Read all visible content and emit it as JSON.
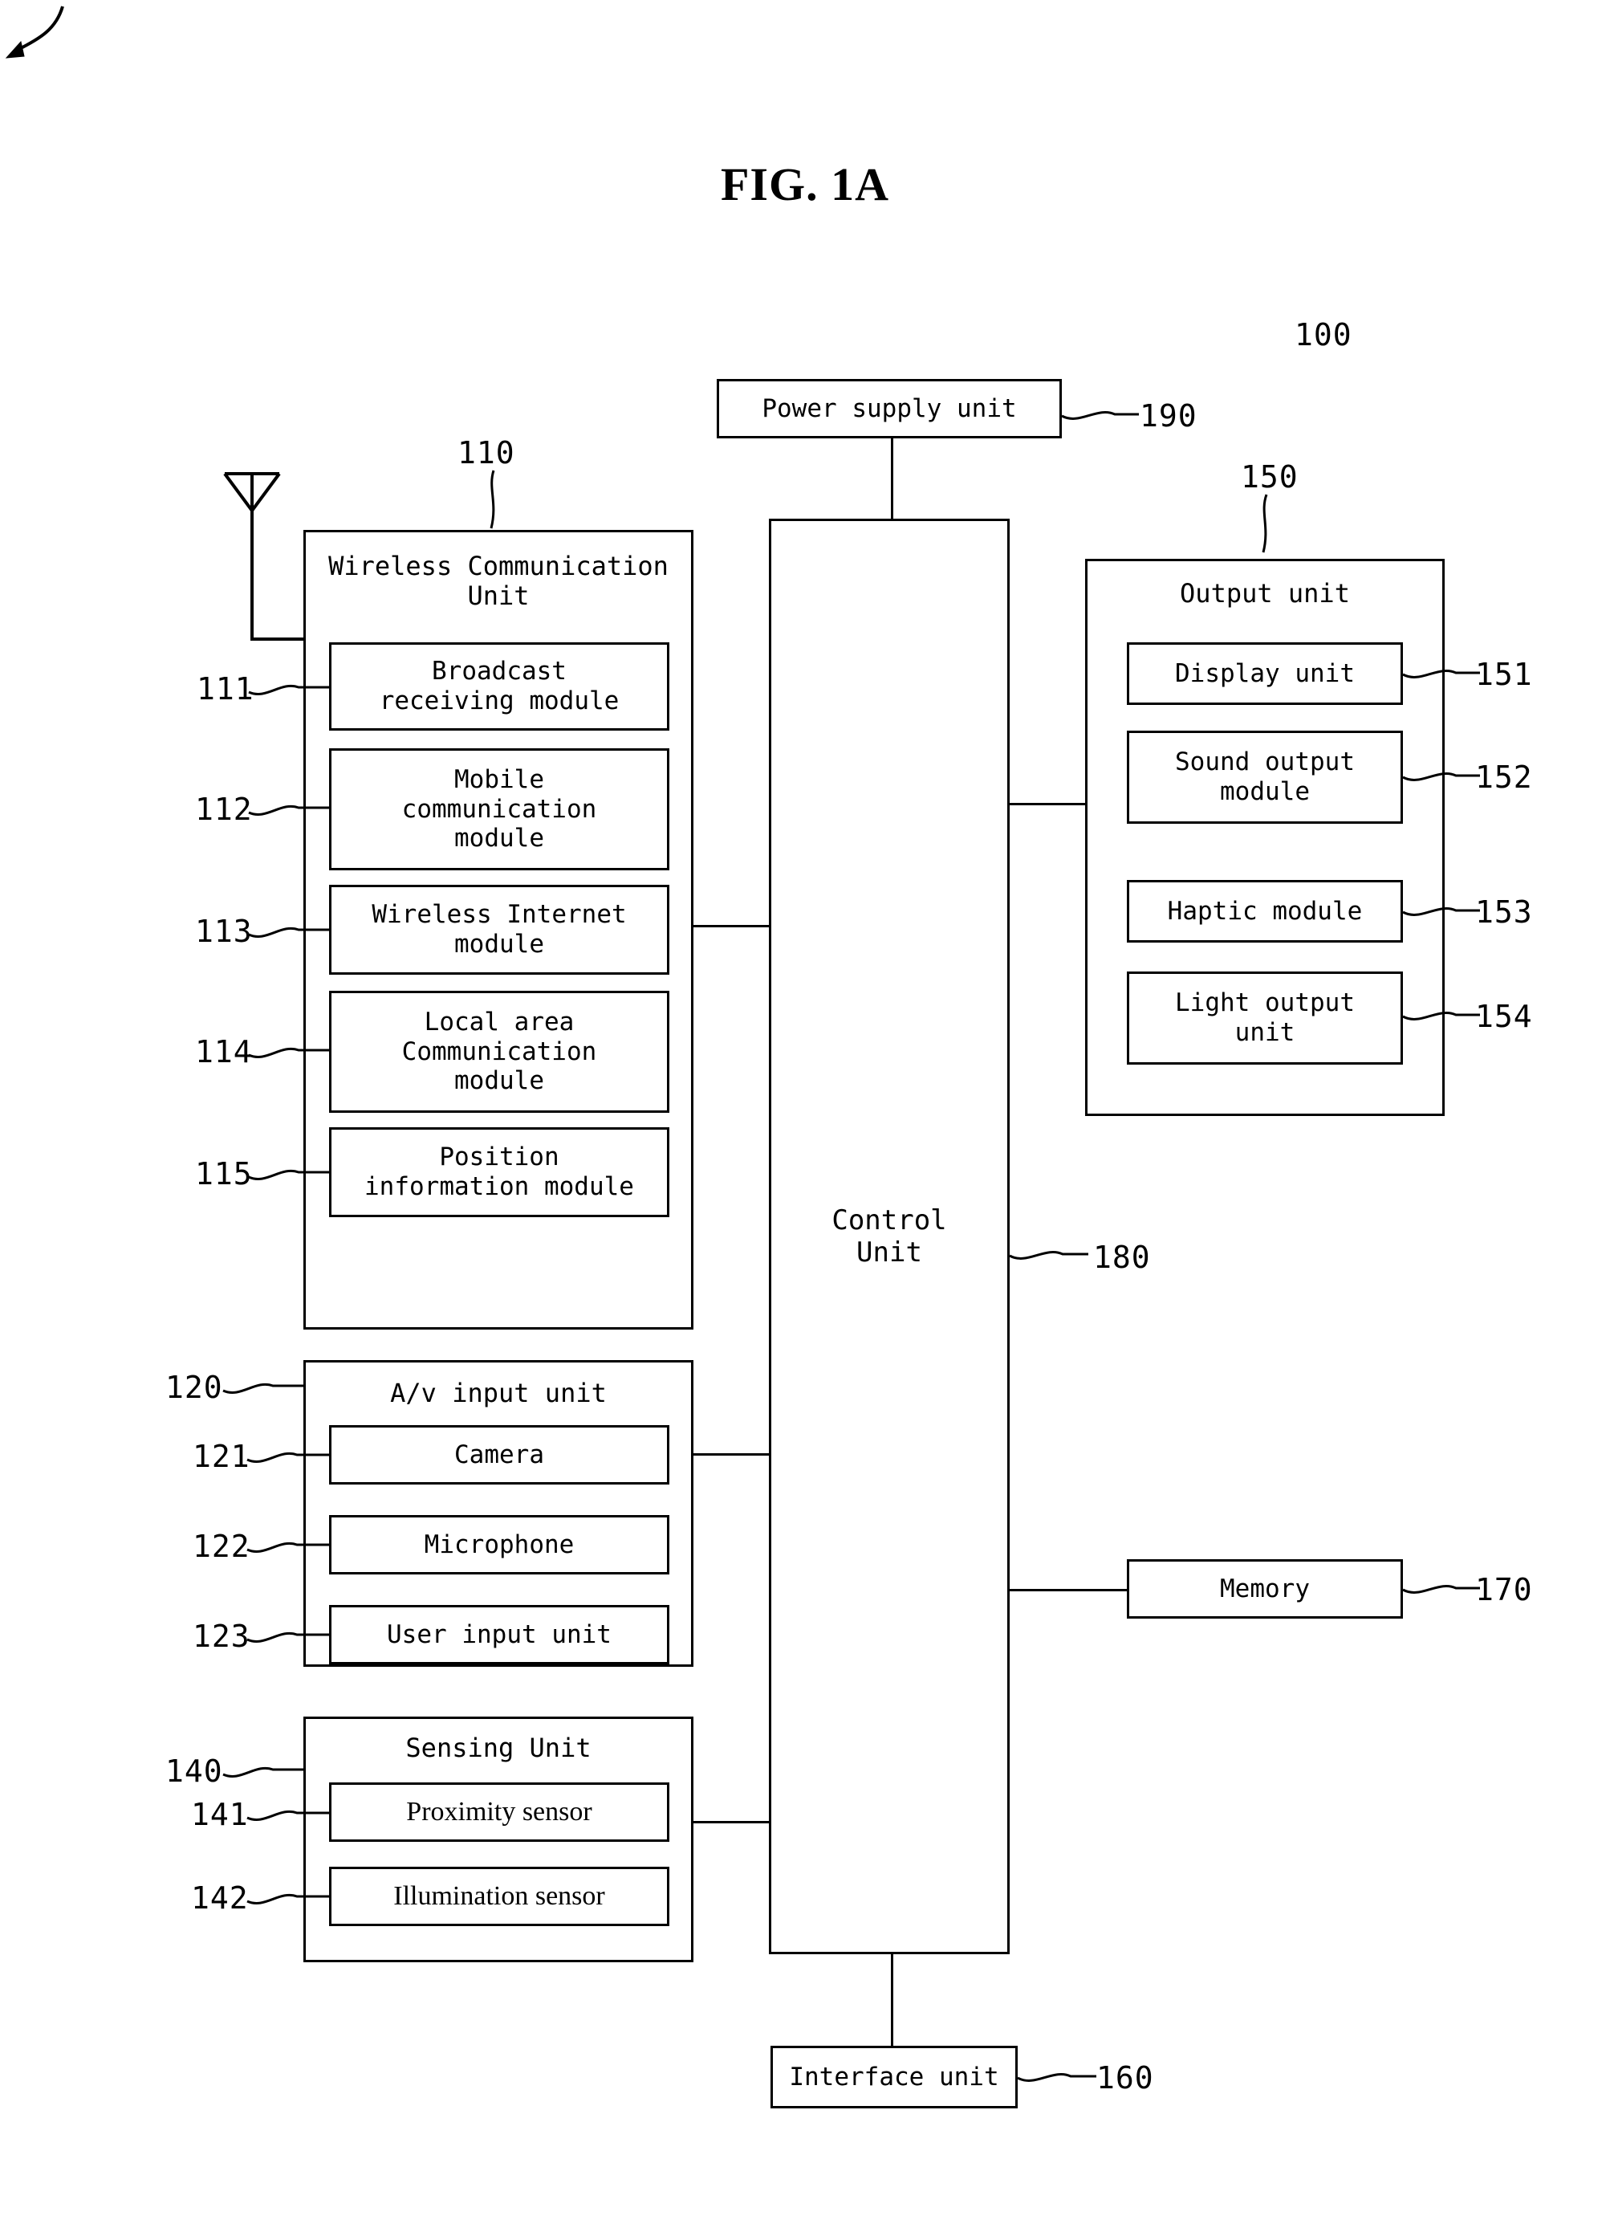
{
  "figure": {
    "title": "FIG. 1A",
    "system_ref": "100"
  },
  "blocks": {
    "power_supply": {
      "label": "Power supply unit",
      "ref": "190"
    },
    "wireless_unit": {
      "label": "Wireless Communication\nUnit",
      "ref": "110",
      "modules": [
        {
          "label": "Broadcast\nreceiving module",
          "ref": "111"
        },
        {
          "label": "Mobile\ncommunication\nmodule",
          "ref": "112"
        },
        {
          "label": "Wireless Internet\nmodule",
          "ref": "113"
        },
        {
          "label": "Local area\nCommunication\nmodule",
          "ref": "114"
        },
        {
          "label": "Position\ninformation module",
          "ref": "115"
        }
      ]
    },
    "av_input_unit": {
      "label": "A/v input unit",
      "ref": "120",
      "modules": [
        {
          "label": "Camera",
          "ref": "121"
        },
        {
          "label": "Microphone",
          "ref": "122"
        },
        {
          "label": "User input unit",
          "ref": "123"
        }
      ]
    },
    "sensing_unit": {
      "label": "Sensing Unit",
      "ref": "140",
      "modules": [
        {
          "label": "Proximity sensor",
          "ref": "141"
        },
        {
          "label": "Illumination sensor",
          "ref": "142"
        }
      ]
    },
    "control_unit": {
      "label": "Control\nUnit",
      "ref": "180"
    },
    "output_unit": {
      "label": "Output unit",
      "ref": "150",
      "modules": [
        {
          "label": "Display unit",
          "ref": "151"
        },
        {
          "label": "Sound output\nmodule",
          "ref": "152"
        },
        {
          "label": "Haptic module",
          "ref": "153"
        },
        {
          "label": "Light output\nunit",
          "ref": "154"
        }
      ]
    },
    "memory": {
      "label": "Memory",
      "ref": "170"
    },
    "interface_unit": {
      "label": "Interface unit",
      "ref": "160"
    }
  },
  "icons": {
    "antenna": "antenna-icon"
  },
  "colors": {
    "stroke": "#000000",
    "background": "#ffffff"
  }
}
